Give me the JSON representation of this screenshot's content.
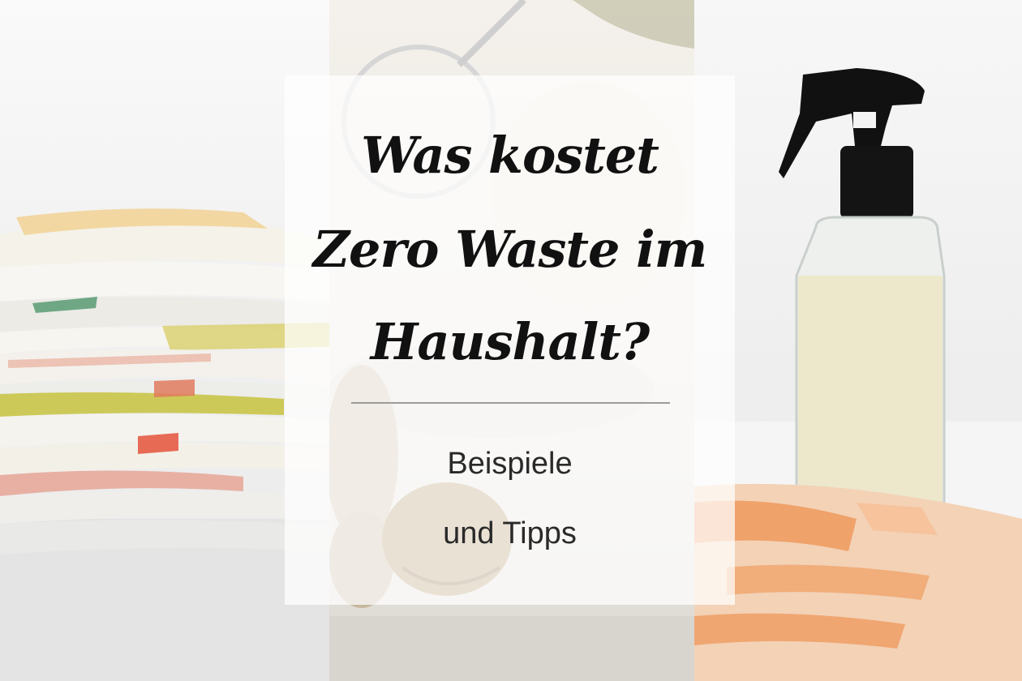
{
  "card": {
    "title_lines": [
      "Was kostet",
      "Zero Waste im",
      "Haushalt?"
    ],
    "subtitle_lines": [
      "Beispiele",
      "und Tipps"
    ]
  },
  "photos": [
    {
      "name": "stacked-cloth-napkins"
    },
    {
      "name": "glass-and-walnuts"
    },
    {
      "name": "spray-bottle-and-orange-cloth"
    }
  ]
}
